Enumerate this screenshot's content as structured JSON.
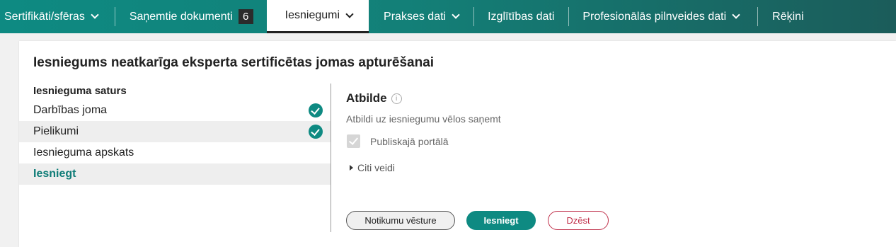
{
  "nav": {
    "items": [
      {
        "label": "Sertifikāti/sfēras"
      },
      {
        "label": "Saņemtie dokumenti",
        "badge": "6"
      },
      {
        "label": "Iesniegumi"
      },
      {
        "label": "Prakses dati"
      },
      {
        "label": "Izglītības dati"
      },
      {
        "label": "Profesionālās pilnveides dati"
      },
      {
        "label": "Rēķini"
      }
    ]
  },
  "card": {
    "title": "Iesniegums neatkarīga eksperta sertificētas jomas apturēšanai",
    "left": {
      "heading": "Iesnieguma saturs",
      "steps": [
        {
          "label": "Darbības joma",
          "completed": true
        },
        {
          "label": "Pielikumi",
          "completed": true
        },
        {
          "label": "Iesnieguma apskats",
          "completed": false
        },
        {
          "label": "Iesniegt",
          "completed": false,
          "current": true
        }
      ]
    },
    "right": {
      "title": "Atbilde",
      "info_icon": "i",
      "description": "Atbildi uz iesniegumu vēlos saņemt",
      "checkbox_label": "Publiskajā portālā",
      "checkbox_checked": true,
      "other_label": "Citi veidi"
    },
    "buttons": {
      "history": "Notikumu vēsture",
      "submit": "Iesniegt",
      "delete": "Dzēst"
    }
  },
  "colors": {
    "accent": "#0e8a82",
    "delete": "#c0304a"
  }
}
